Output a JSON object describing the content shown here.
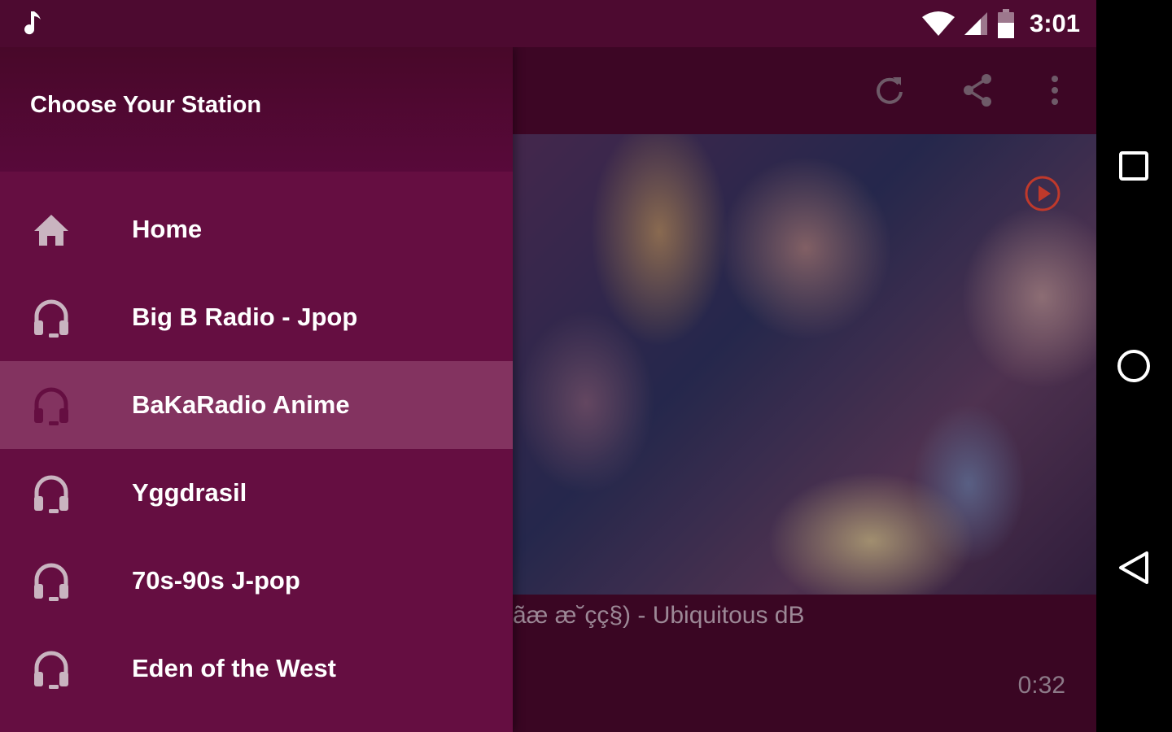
{
  "status_bar": {
    "time": "3:01",
    "icons": [
      "music-note-icon",
      "wifi-icon",
      "signal-icon",
      "battery-icon"
    ]
  },
  "drawer": {
    "title": "Choose Your Station",
    "items": [
      {
        "label": "Home",
        "icon": "home-icon",
        "selected": false
      },
      {
        "label": "Big B Radio - Jpop",
        "icon": "headphones-icon",
        "selected": false
      },
      {
        "label": "BaKaRadio Anime",
        "icon": "headphones-icon",
        "selected": true
      },
      {
        "label": "Yggdrasil",
        "icon": "headphones-icon",
        "selected": false
      },
      {
        "label": "70s-90s J-pop",
        "icon": "headphones-icon",
        "selected": false
      },
      {
        "label": "Eden of the West",
        "icon": "headphones-icon",
        "selected": false
      }
    ]
  },
  "toolbar": {
    "actions": [
      "refresh-icon",
      "share-icon",
      "more-vert-icon"
    ]
  },
  "player": {
    "track_title": "ãæ æ˘çç§) - Ubiquitous dB",
    "elapsed": "0:32"
  },
  "nav_bar": {
    "buttons": [
      "recents-icon",
      "home-circle-icon",
      "back-icon"
    ]
  },
  "colors": {
    "primary_dark": "#4d0a30",
    "drawer_bg": "#650e41",
    "selected_bg": "#833360",
    "accent": "#c0392b"
  }
}
